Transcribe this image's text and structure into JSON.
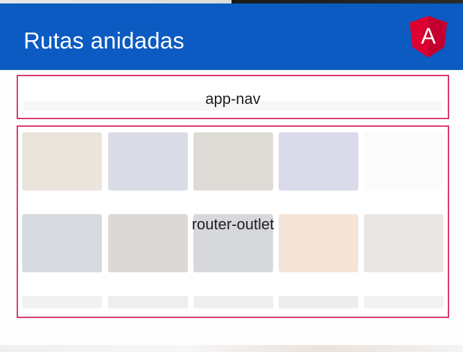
{
  "header": {
    "title": "Rutas anidadas",
    "logo_letter": "A",
    "background_color": "#0b5bc2"
  },
  "boxes": {
    "nav_label": "app-nav",
    "outlet_label": "router-outlet",
    "border_color": "#d7376a"
  },
  "logo": {
    "icon": "angular-logo-icon",
    "colors": [
      "#dd0031",
      "#c3002f",
      "#ffffff"
    ]
  }
}
